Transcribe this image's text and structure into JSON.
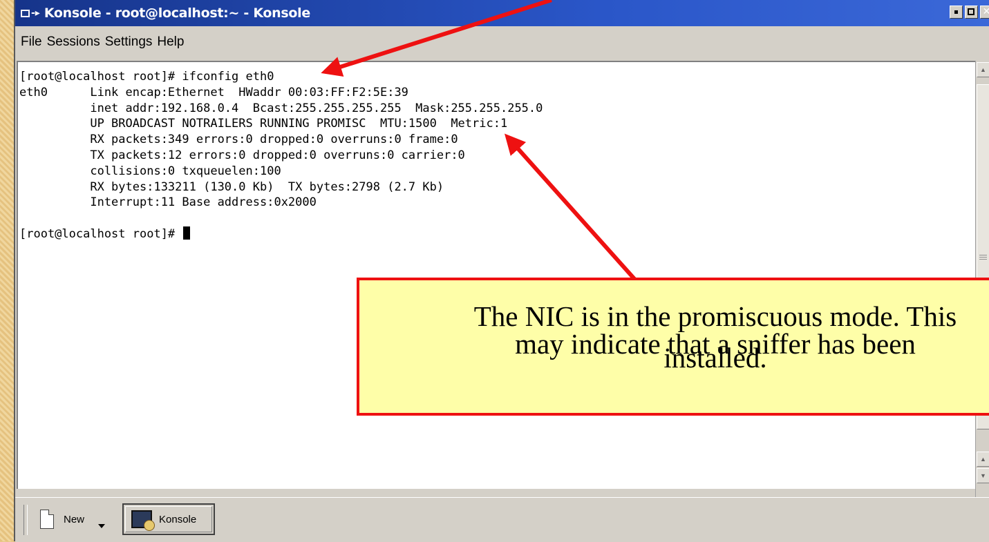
{
  "window": {
    "title": "Konsole - root@localhost:~ - Konsole",
    "buttons": {
      "minimize": "minimize",
      "maximize": "maximize",
      "close": "✕"
    }
  },
  "menubar": {
    "items": [
      "File",
      "Sessions",
      "Settings",
      "Help"
    ]
  },
  "terminal": {
    "lines": [
      "[root@localhost root]# ifconfig eth0",
      "eth0      Link encap:Ethernet  HWaddr 00:03:FF:F2:5E:39",
      "          inet addr:192.168.0.4  Bcast:255.255.255.255  Mask:255.255.255.0",
      "          UP BROADCAST NOTRAILERS RUNNING PROMISC  MTU:1500  Metric:1",
      "          RX packets:349 errors:0 dropped:0 overruns:0 frame:0",
      "          TX packets:12 errors:0 dropped:0 overruns:0 carrier:0",
      "          collisions:0 txqueuelen:100",
      "          RX bytes:133211 (130.0 Kb)  TX bytes:2798 (2.7 Kb)",
      "          Interrupt:11 Base address:0x2000",
      ""
    ],
    "prompt": "[root@localhost root]# "
  },
  "taskbar": {
    "new_label": "New",
    "konsole_label": "Konsole"
  },
  "callout": {
    "line1": "The NIC is in the promiscuous mode. This",
    "line2": "may indicate that a sniffer has been",
    "line3": "installed."
  },
  "colors": {
    "titlebar": "#2a56c8",
    "callout_bg": "#fefea8",
    "callout_border": "#ee1111",
    "arrow": "#ee1111"
  }
}
